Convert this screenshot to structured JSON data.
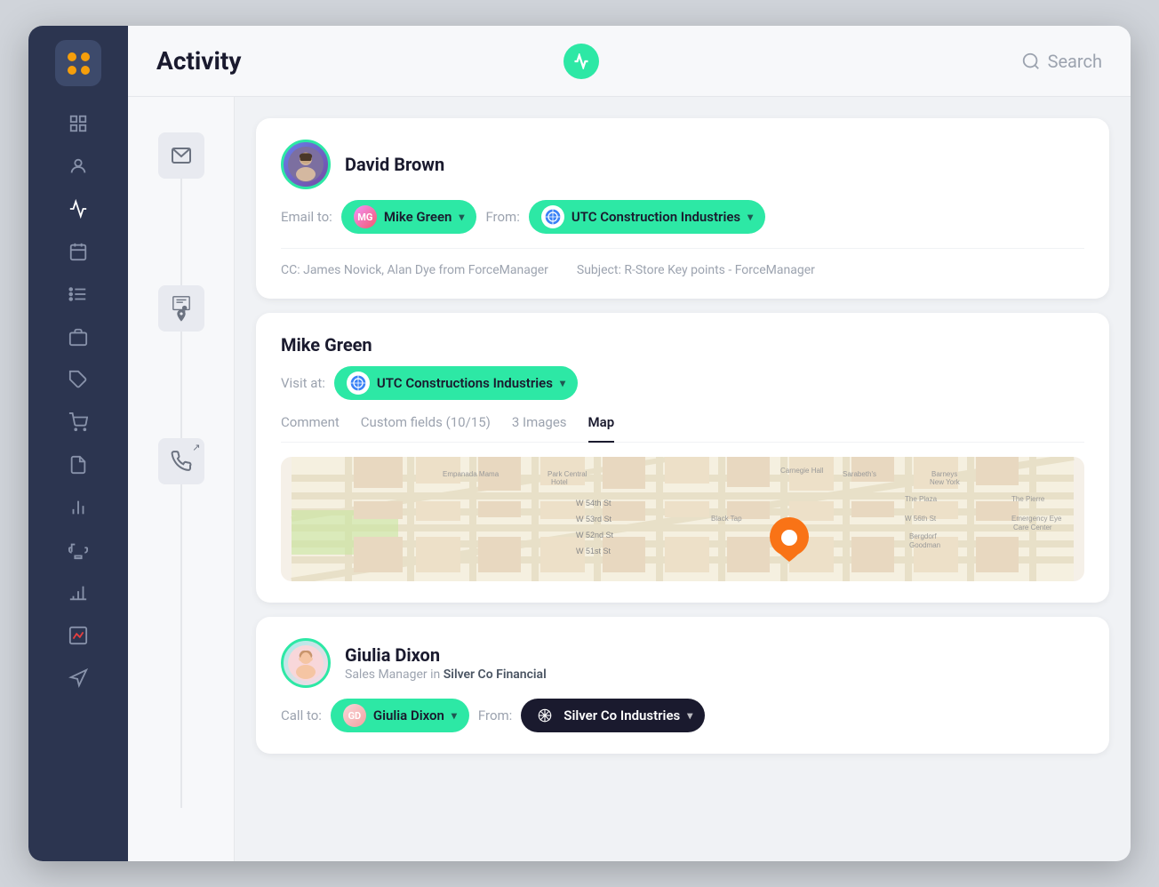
{
  "header": {
    "title": "Activity",
    "add_button_label": "+",
    "search_placeholder": "Search"
  },
  "sidebar": {
    "items": [
      {
        "id": "grid",
        "icon": "⊞"
      },
      {
        "id": "person",
        "icon": "👤"
      },
      {
        "id": "activity",
        "icon": "⚡"
      },
      {
        "id": "calendar",
        "icon": "📅"
      },
      {
        "id": "list",
        "icon": "📋"
      },
      {
        "id": "briefcase",
        "icon": "💼"
      },
      {
        "id": "tag",
        "icon": "🏷"
      },
      {
        "id": "cart",
        "icon": "🛒"
      },
      {
        "id": "document",
        "icon": "📄"
      },
      {
        "id": "chart",
        "icon": "📊"
      },
      {
        "id": "trophy",
        "icon": "🏆"
      },
      {
        "id": "bar-chart",
        "icon": "📈"
      },
      {
        "id": "report",
        "icon": "📉"
      },
      {
        "id": "megaphone",
        "icon": "📣"
      }
    ]
  },
  "cards": {
    "card1": {
      "person_name": "David Brown",
      "email_label": "Email to:",
      "to_person": "Mike Green",
      "from_label": "From:",
      "from_company": "UTC Construction Industries",
      "cc_text": "CC: James Novick, Alan Dye from ForceManager",
      "subject_text": "Subject: R-Store Key points - ForceManager"
    },
    "card2": {
      "person_name": "Mike Green",
      "visit_label": "Visit at:",
      "visit_company": "UTC Constructions Industries",
      "tabs": [
        {
          "label": "Comment",
          "active": false
        },
        {
          "label": "Custom fields (10/15)",
          "active": false
        },
        {
          "label": "3 Images",
          "active": false
        },
        {
          "label": "Map",
          "active": true
        }
      ]
    },
    "card3": {
      "person_name": "Giulia Dixon",
      "person_subtitle": "Sales Manager in",
      "person_company": "Silver Co Financial",
      "call_label": "Call to:",
      "call_person": "Giulia Dixon",
      "from_label": "From:",
      "from_company": "Silver Co Industries"
    }
  },
  "left_panel": {
    "icons": [
      {
        "type": "email",
        "symbol": "✉"
      },
      {
        "type": "location",
        "symbol": "📍"
      },
      {
        "type": "phone",
        "symbol": "📞"
      }
    ]
  }
}
